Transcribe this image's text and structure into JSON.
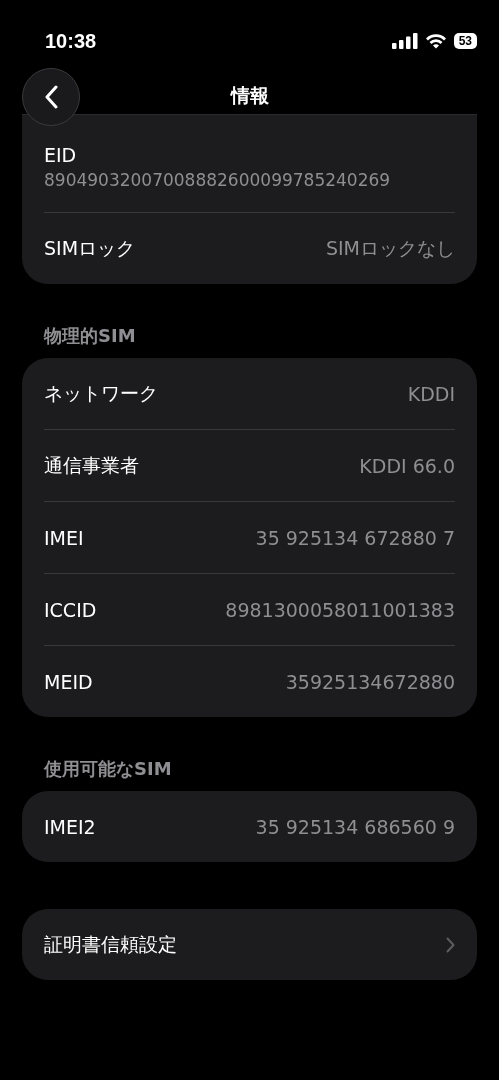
{
  "status_bar": {
    "time": "10:38",
    "battery": "53"
  },
  "nav": {
    "title": "情報"
  },
  "sections": [
    {
      "rows": [
        {
          "kind": "stacked",
          "label": "EID",
          "value": "89049032007008882600099785240269"
        },
        {
          "kind": "pair",
          "label": "SIMロック",
          "value": "SIMロックなし"
        }
      ]
    },
    {
      "header": "物理的SIM",
      "rows": [
        {
          "kind": "pair",
          "label": "ネットワーク",
          "value": "KDDI"
        },
        {
          "kind": "pair",
          "label": "通信事業者",
          "value": "KDDI 66.0"
        },
        {
          "kind": "pair",
          "label": "IMEI",
          "value": "35 925134 672880 7"
        },
        {
          "kind": "pair",
          "label": "ICCID",
          "value": "8981300058011001383"
        },
        {
          "kind": "pair",
          "label": "MEID",
          "value": "35925134672880"
        }
      ]
    },
    {
      "header": "使用可能なSIM",
      "rows": [
        {
          "kind": "pair",
          "label": "IMEI2",
          "value": "35 925134 686560 9"
        }
      ]
    },
    {
      "rows": [
        {
          "kind": "link",
          "label": "証明書信頼設定"
        }
      ]
    }
  ]
}
